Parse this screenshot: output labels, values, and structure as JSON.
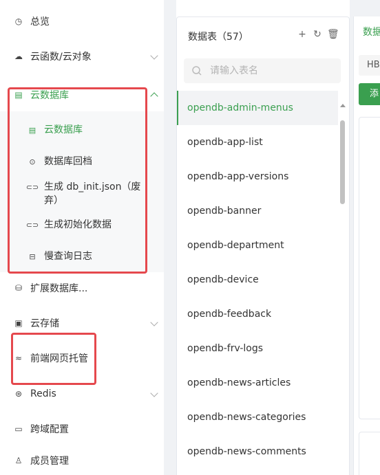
{
  "sidebar": {
    "items": [
      {
        "label": "总览",
        "icon": "clock-icon"
      },
      {
        "label": "云函数/云对象",
        "icon": "cloud-icon"
      },
      {
        "label": "云数据库",
        "icon": "table-icon"
      },
      {
        "label": "扩展数据库...",
        "icon": "database-icon"
      },
      {
        "label": "云存储",
        "icon": "storage-icon"
      },
      {
        "label": "前端网页托管",
        "icon": "web-hosting-icon"
      },
      {
        "label": "Redis",
        "icon": "redis-icon"
      },
      {
        "label": "跨域配置",
        "icon": "cors-icon"
      },
      {
        "label": "成员管理",
        "icon": "member-icon"
      }
    ],
    "database_submenu": [
      {
        "label": "云数据库",
        "icon": "table-icon"
      },
      {
        "label": "数据库回档",
        "icon": "rollback-icon"
      },
      {
        "label": "生成 db_init.json（废弃）",
        "icon": "link-icon"
      },
      {
        "label": "生成初始化数据",
        "icon": "link-icon"
      },
      {
        "label": "慢查询日志",
        "icon": "log-icon"
      }
    ]
  },
  "table_panel": {
    "title": "数据表（57）",
    "search_placeholder": "请输入表名",
    "tables": [
      "opendb-admin-menus",
      "opendb-app-list",
      "opendb-app-versions",
      "opendb-banner",
      "opendb-department",
      "opendb-device",
      "opendb-feedback",
      "opendb-frv-logs",
      "opendb-news-articles",
      "opendb-news-categories",
      "opendb-news-comments"
    ]
  },
  "right_panel": {
    "title": "数据",
    "tab": "HB",
    "button": "添"
  },
  "colors": {
    "accent": "#3a9f4f",
    "highlight_box": "#e5484d"
  }
}
